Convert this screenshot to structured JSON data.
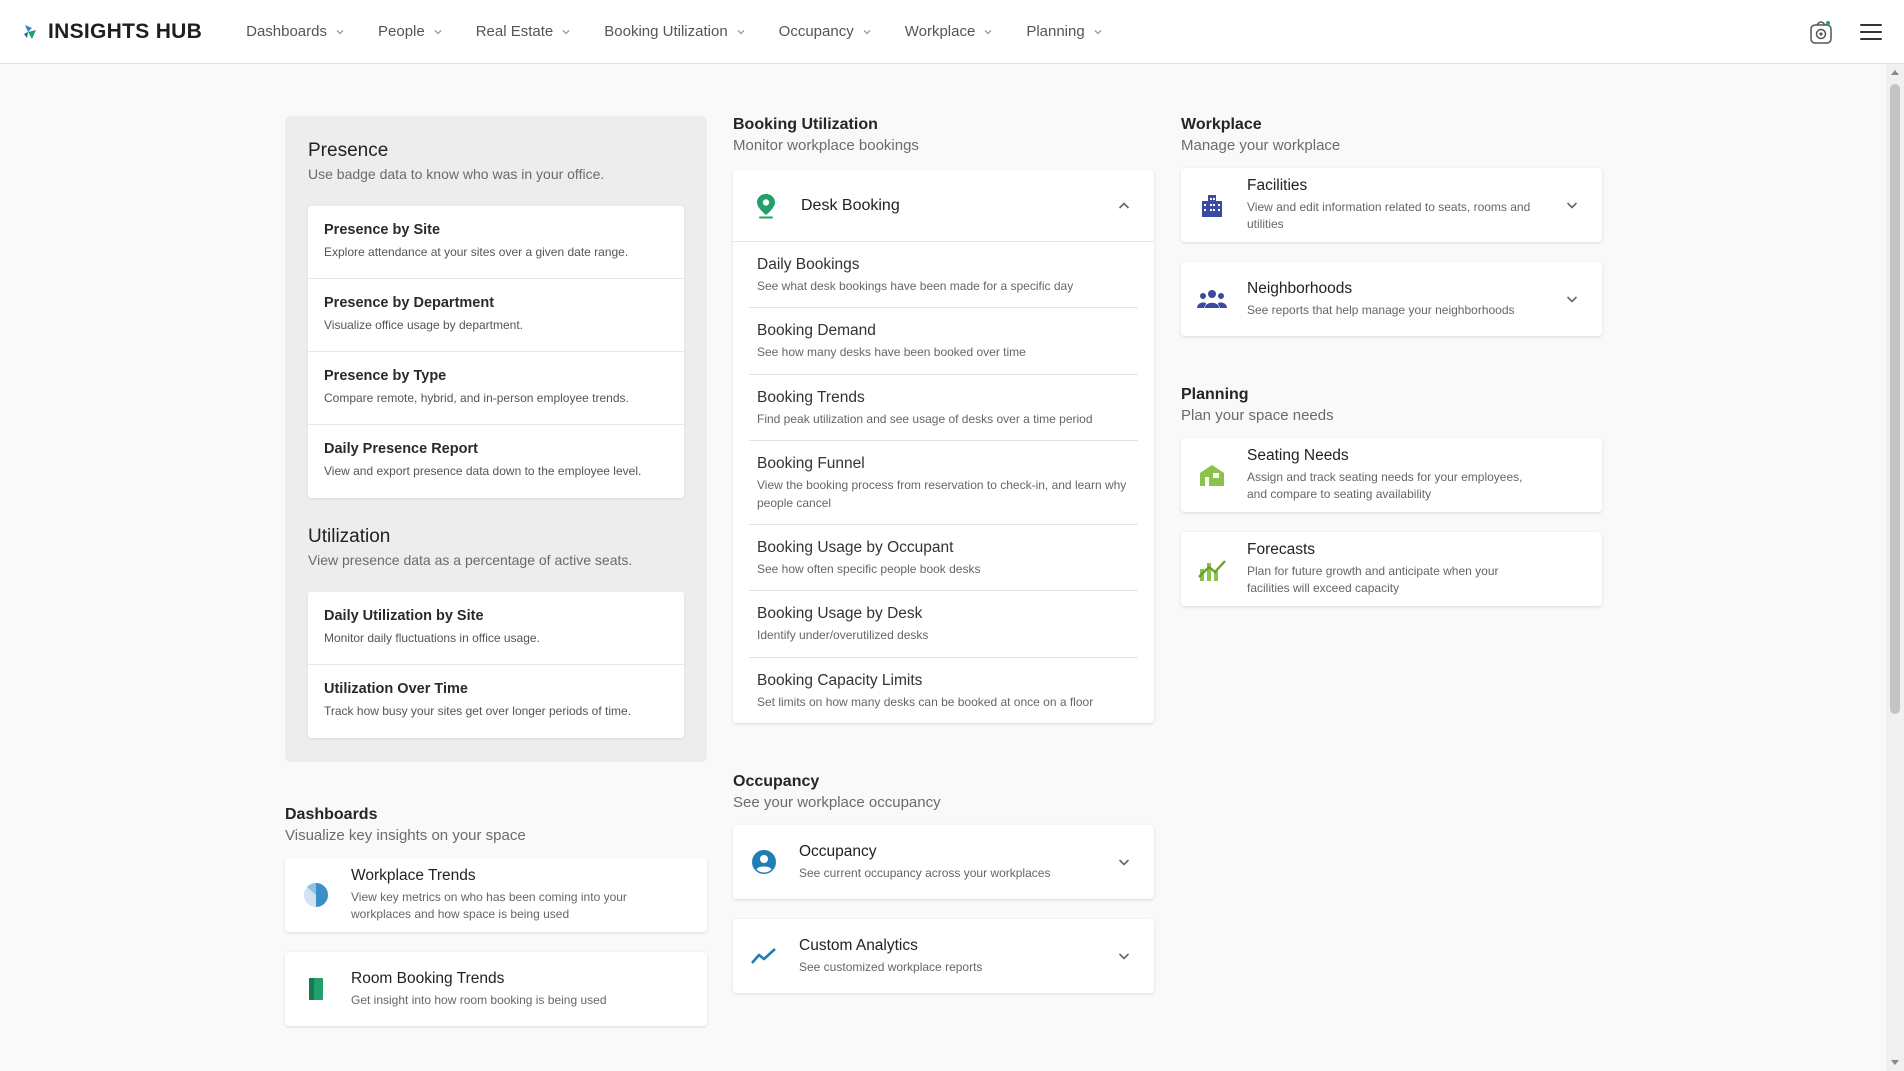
{
  "header": {
    "brand": "INSIGHTS HUB",
    "nav": [
      "Dashboards",
      "People",
      "Real Estate",
      "Booking Utilization",
      "Occupancy",
      "Workplace",
      "Planning"
    ]
  },
  "colors": {
    "accent_green": "#22a06b",
    "accent_blue": "#1f7fb5",
    "accent_navy": "#3a4aa0",
    "planning_green": "#8bc34a"
  },
  "presence": {
    "title": "Presence",
    "subtitle": "Use badge data to know who was in your office.",
    "items": [
      {
        "title": "Presence by Site",
        "desc": "Explore attendance at your sites over a given date range."
      },
      {
        "title": "Presence by Department",
        "desc": "Visualize office usage by department."
      },
      {
        "title": "Presence by Type",
        "desc": "Compare remote, hybrid, and in-person employee trends."
      },
      {
        "title": "Daily Presence Report",
        "desc": "View and export presence data down to the employee level."
      }
    ]
  },
  "utilization": {
    "title": "Utilization",
    "subtitle": "View presence data as a percentage of active seats.",
    "items": [
      {
        "title": "Daily Utilization by Site",
        "desc": "Monitor daily fluctuations in office usage."
      },
      {
        "title": "Utilization Over Time",
        "desc": "Track how busy your sites get over longer periods of time."
      }
    ]
  },
  "dashboards": {
    "title": "Dashboards",
    "subtitle": "Visualize key insights on your space",
    "tiles": [
      {
        "title": "Workplace Trends",
        "desc": "View key metrics on who has been coming into your workplaces and how space is being used",
        "icon": "pie-chart-icon"
      },
      {
        "title": "Room Booking Trends",
        "desc": "Get insight into how room booking is being used",
        "icon": "door-icon"
      }
    ]
  },
  "booking": {
    "title": "Booking Utilization",
    "subtitle": "Monitor workplace bookings",
    "desk": {
      "title": "Desk Booking",
      "items": [
        {
          "title": "Daily Bookings",
          "desc": "See what desk bookings have been made for a specific day"
        },
        {
          "title": "Booking Demand",
          "desc": "See how many desks have been booked over time"
        },
        {
          "title": "Booking Trends",
          "desc": "Find peak utilization and see usage of desks over a time period"
        },
        {
          "title": "Booking Funnel",
          "desc": "View the booking process from reservation to check-in, and learn why people cancel"
        },
        {
          "title": "Booking Usage by Occupant",
          "desc": "See how often specific people book desks"
        },
        {
          "title": "Booking Usage by Desk",
          "desc": "Identify under/overutilized desks"
        },
        {
          "title": "Booking Capacity Limits",
          "desc": "Set limits on how many desks can be booked at once on a floor"
        }
      ]
    }
  },
  "occupancy": {
    "title": "Occupancy",
    "subtitle": "See your workplace occupancy",
    "tiles": [
      {
        "title": "Occupancy",
        "desc": "See current occupancy across your workplaces"
      },
      {
        "title": "Custom Analytics",
        "desc": "See customized workplace reports"
      }
    ]
  },
  "workplace": {
    "title": "Workplace",
    "subtitle": "Manage your workplace",
    "tiles": [
      {
        "title": "Facilities",
        "desc": "View and edit information related to seats, rooms and utilities"
      },
      {
        "title": "Neighborhoods",
        "desc": "See reports that help manage your neighborhoods"
      }
    ]
  },
  "planning": {
    "title": "Planning",
    "subtitle": "Plan your space needs",
    "tiles": [
      {
        "title": "Seating Needs",
        "desc": "Assign and track seating needs for your employees, and compare to seating availability"
      },
      {
        "title": "Forecasts",
        "desc": "Plan for future growth and anticipate when your facilities will exceed capacity"
      }
    ]
  }
}
